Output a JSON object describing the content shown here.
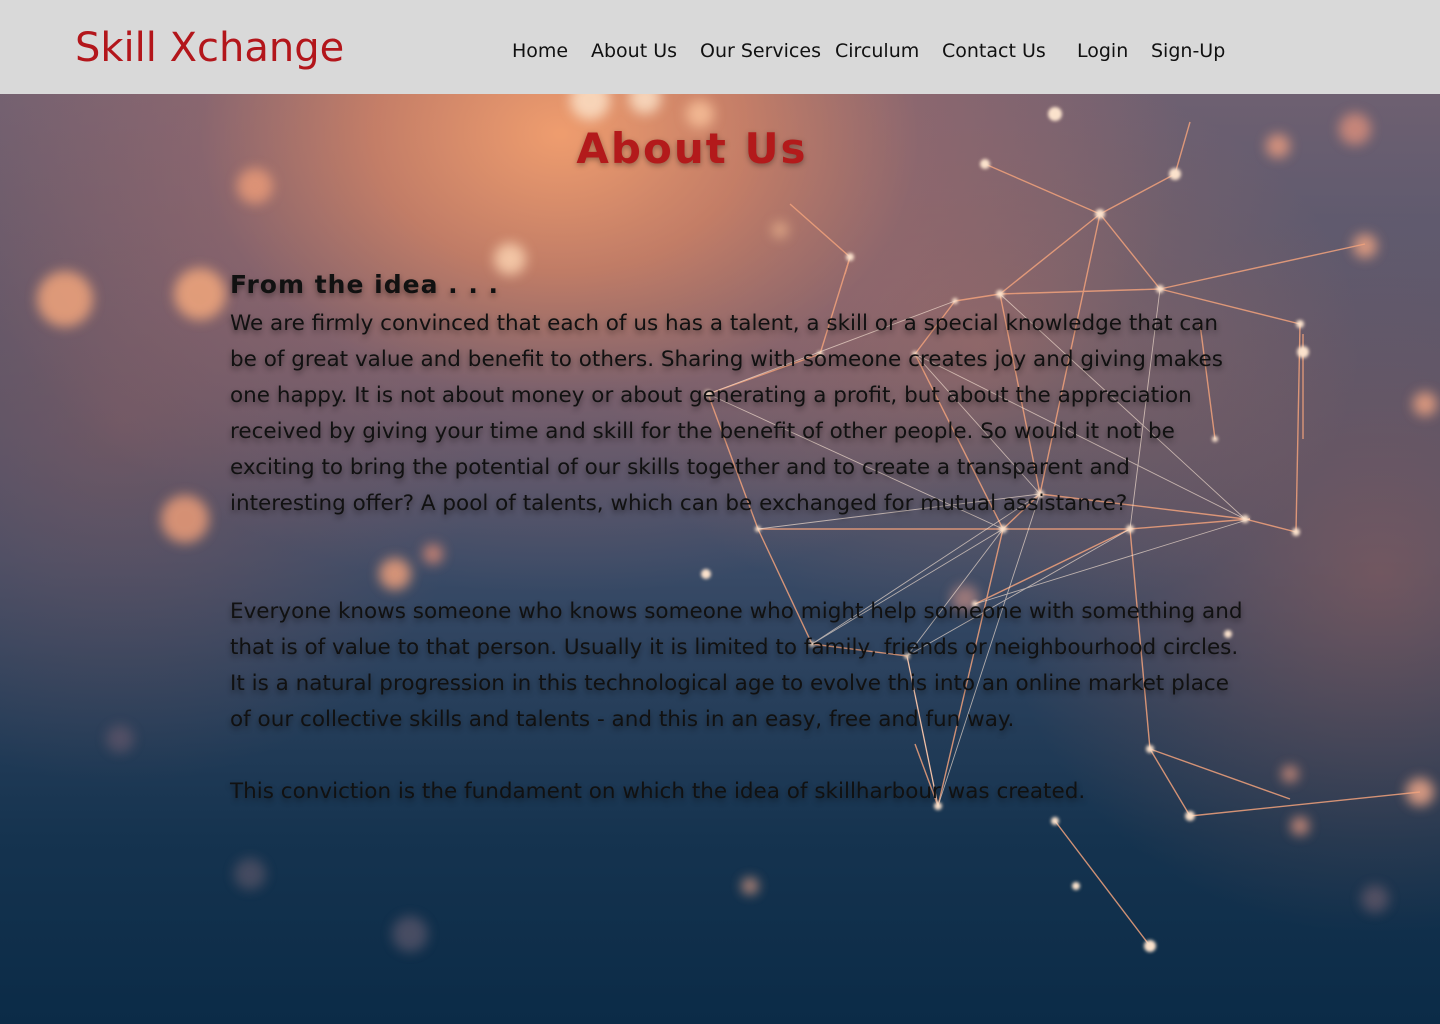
{
  "header": {
    "brand": "Skill Xchange",
    "nav": [
      "Home",
      "About Us",
      "Our Services",
      "Circulum",
      "Contact Us",
      "Login",
      "Sign-Up"
    ]
  },
  "main": {
    "title": "About Us",
    "subheading": "From the idea . . .",
    "paragraphs": [
      "We are firmly convinced that each of us has a talent, a skill or a special knowledge that can be of great value and benefit to others. Sharing with someone creates joy and giving makes one happy. It is not about money or about generating a profit, but about the appreciation received by giving your time and skill for the benefit of other people. So would it not be exciting to bring the potential of our skills together and to create a transparent and interesting offer? A pool of talents, which can be exchanged for mutual assistance?",
      "Everyone knows someone who knows someone who might help someone with something and that is of value to that person. Usually it is limited to family, friends or neighbourhood circles. It is a natural progression in this technological age to evolve this into an online market place of our collective skills and talents - and this in an easy, free and fun way.",
      "This conviction is the fundament on which the idea of skillharbour was created."
    ]
  },
  "colors": {
    "brand": "#b3161b",
    "navbar_bg": "#d9d9d9",
    "title": "#b31a1b",
    "text": "#111111"
  }
}
